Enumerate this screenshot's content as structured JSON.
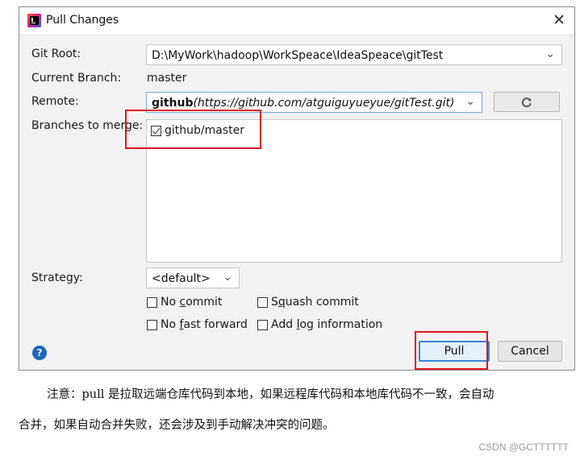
{
  "window": {
    "title": "Pull Changes",
    "close_glyph": "✕"
  },
  "form": {
    "git_root_label": "Git Root:",
    "git_root_value": "D:\\MyWork\\hadoop\\WorkSpeace\\IdeaSpeace\\gitTest",
    "current_branch_label": "Current Branch:",
    "current_branch_value": "master",
    "remote_label": "Remote:",
    "remote_name": "github",
    "remote_url": "(https://github.com/atguiguyueyue/gitTest.git)",
    "branches_label": "Branches to merge:",
    "branches": [
      {
        "name": "github/master",
        "checked": true
      }
    ],
    "strategy_label": "Strategy:",
    "strategy_value": "<default>",
    "options": {
      "no_commit": {
        "pre": "No ",
        "u": "c",
        "post": "ommit",
        "checked": false
      },
      "squash_commit": {
        "pre": "S",
        "u": "q",
        "post": "uash commit",
        "checked": false
      },
      "no_fast_forward": {
        "pre": "No ",
        "u": "f",
        "post": "ast forward",
        "checked": false
      },
      "add_log_information": {
        "pre": "Add ",
        "u": "l",
        "post": "og information",
        "checked": false
      }
    }
  },
  "buttons": {
    "help": "?",
    "pull": "Pull",
    "cancel": "Cancel"
  },
  "icons": {
    "app": "intellij-idea-icon",
    "refresh": "refresh-icon",
    "dropdown": "chevron-down-icon",
    "help": "help-icon",
    "close": "close-icon"
  },
  "colors": {
    "highlight_box": "#e0141e",
    "primary_button_border": "#3c82d8",
    "help_icon": "#1a66c2"
  },
  "caption": {
    "line1": "注意：pull 是拉取远端仓库代码到本地，如果远程库代码和本地库代码不一致，会自动",
    "line2": "合并，如果自动合并失败，还会涉及到手动解决冲突的问题。"
  },
  "watermark": "CSDN @GCTTTTTT"
}
